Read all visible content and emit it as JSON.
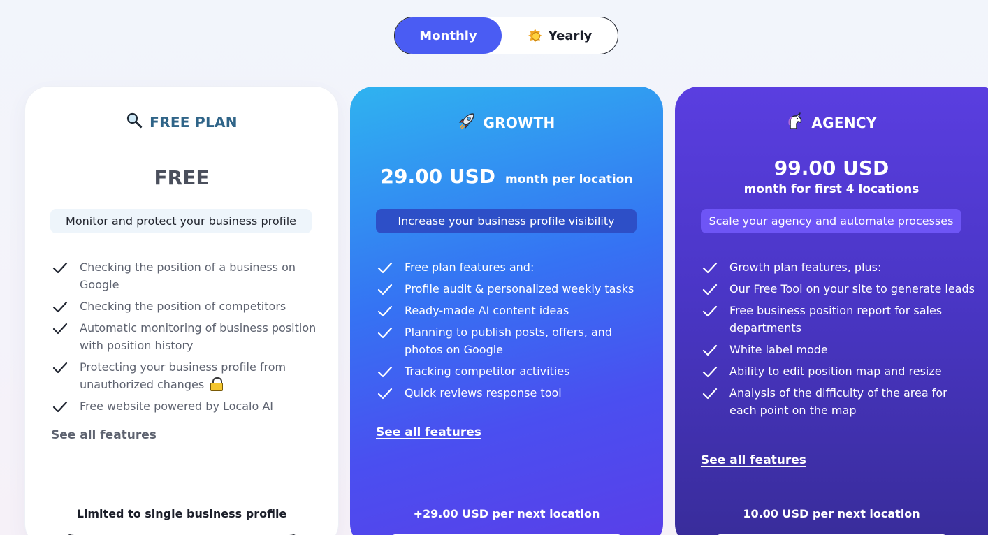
{
  "billing_toggle": {
    "monthly_label": "Monthly",
    "yearly_label": "Yearly",
    "selected": "Monthly",
    "yearly_icon": "sun-icon"
  },
  "plans": [
    {
      "icon": "magnifier-icon",
      "title": "FREE PLAN",
      "price": "FREE",
      "tagline": "Monitor and protect your business profile",
      "features": [
        "Checking the position of a business on Google",
        "Checking the position of competitors",
        "Automatic monitoring of business position with position history",
        "Protecting your business profile from unauthorized changes",
        "Free website powered by Localo AI"
      ],
      "see_all": "See all features",
      "footnote": "Limited to single business profile"
    },
    {
      "icon": "rocket-icon",
      "title": "GROWTH",
      "price": "29.00 USD",
      "price_unit": "month per location",
      "tagline": "Increase your business profile visibility",
      "features": [
        "Free plan features and:",
        "Profile audit & personalized weekly tasks",
        "Ready-made AI content ideas",
        "Planning to publish posts, offers, and photos on Google",
        "Tracking competitor activities",
        "Quick reviews response tool"
      ],
      "see_all": "See all features",
      "footnote": "+29.00 USD per next location"
    },
    {
      "icon": "unicorn-icon",
      "title": "AGENCY",
      "price": "99.00 USD",
      "price_unit": "month for first 4 locations",
      "tagline": "Scale your agency and automate processes",
      "features": [
        "Growth plan features, plus:",
        "Our Free Tool on your site to generate leads",
        "Free business position report for sales departments",
        "White label mode",
        "Ability to edit position map and resize",
        "Analysis of the difficulty of the area for each point on the map"
      ],
      "see_all": "See all features",
      "footnote": "10.00 USD per next location"
    }
  ],
  "colors": {
    "toggle_active": "#4a5cf3",
    "free_title": "#2f6488",
    "growth_gradient_start": "#2fb3f0",
    "growth_gradient_end": "#5a3ee8",
    "agency_gradient_start": "#5a3ee0",
    "agency_gradient_end": "#382c99"
  }
}
